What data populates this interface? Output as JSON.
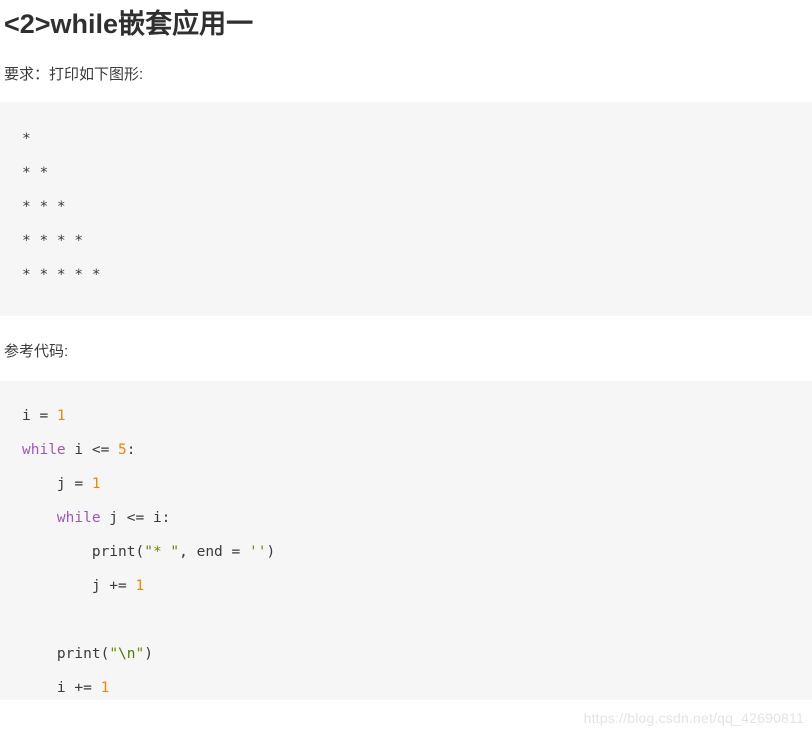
{
  "article": {
    "heading": "<2>while嵌套应用一",
    "requirement_label": "要求：打印如下图形:",
    "reference_code_label": "参考代码:"
  },
  "output_block": {
    "lines": [
      "*",
      "* *",
      "* * *",
      "* * * *",
      "* * * * *"
    ]
  },
  "code_block": {
    "lines": [
      {
        "segments": [
          {
            "t": "i = ",
            "c": "plain"
          },
          {
            "t": "1",
            "c": "num"
          }
        ]
      },
      {
        "segments": [
          {
            "t": "while",
            "c": "kw"
          },
          {
            "t": " i <= ",
            "c": "plain"
          },
          {
            "t": "5",
            "c": "num"
          },
          {
            "t": ":",
            "c": "plain"
          }
        ]
      },
      {
        "segments": [
          {
            "t": "    j = ",
            "c": "plain"
          },
          {
            "t": "1",
            "c": "num"
          }
        ]
      },
      {
        "segments": [
          {
            "t": "    ",
            "c": "plain"
          },
          {
            "t": "while",
            "c": "kw"
          },
          {
            "t": " j <= i:",
            "c": "plain"
          }
        ]
      },
      {
        "segments": [
          {
            "t": "        print(",
            "c": "plain"
          },
          {
            "t": "\"* \"",
            "c": "str"
          },
          {
            "t": ", end = ",
            "c": "plain"
          },
          {
            "t": "''",
            "c": "str"
          },
          {
            "t": ")",
            "c": "plain"
          }
        ]
      },
      {
        "segments": [
          {
            "t": "        j += ",
            "c": "plain"
          },
          {
            "t": "1",
            "c": "num"
          }
        ]
      },
      {
        "segments": [
          {
            "t": "",
            "c": "plain"
          }
        ]
      },
      {
        "segments": [
          {
            "t": "    print(",
            "c": "plain"
          },
          {
            "t": "\"",
            "c": "str"
          },
          {
            "t": "\\n",
            "c": "esc"
          },
          {
            "t": "\"",
            "c": "str"
          },
          {
            "t": ")",
            "c": "plain"
          }
        ]
      },
      {
        "segments": [
          {
            "t": "    i += ",
            "c": "plain"
          },
          {
            "t": "1",
            "c": "num"
          }
        ]
      }
    ]
  },
  "watermark": {
    "text": "https://blog.csdn.net/qq_42690811"
  },
  "colors": {
    "code_background": "#f6f6f6",
    "keyword": "#9b59b6",
    "number": "#e8870c",
    "string": "#6a8a00",
    "text": "#3a3a3a",
    "heading": "#2f2f2f",
    "watermark": "#e4e4e4"
  }
}
